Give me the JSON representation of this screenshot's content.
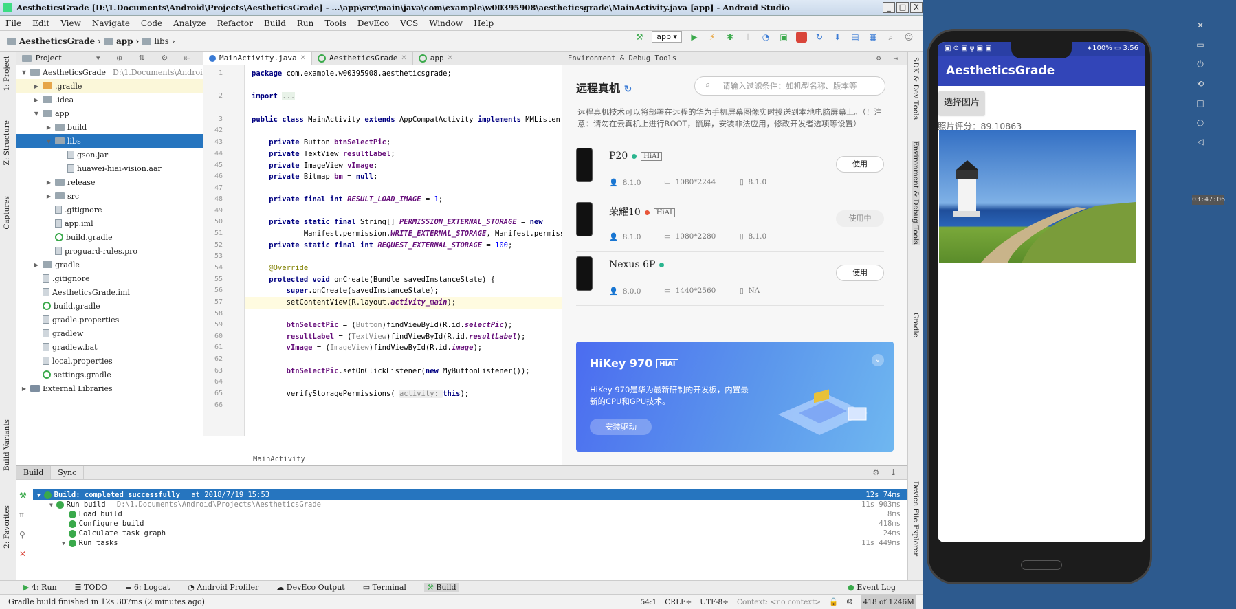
{
  "window": {
    "title": "AestheticsGrade [D:\\1.Documents\\Android\\Projects\\AestheticsGrade] - ...\\app\\src\\main\\java\\com\\example\\w00395908\\aestheticsgrade\\MainActivity.java [app] - Android Studio",
    "min": "_",
    "max": "□",
    "close": "X"
  },
  "menu": [
    "File",
    "Edit",
    "View",
    "Navigate",
    "Code",
    "Analyze",
    "Refactor",
    "Build",
    "Run",
    "Tools",
    "DevEco",
    "VCS",
    "Window",
    "Help"
  ],
  "breadcrumb": [
    "AestheticsGrade",
    "app",
    "libs"
  ],
  "run_config": "app",
  "left_tabs": [
    "1: Project",
    "Z: Structure",
    "Captures",
    "Build Variants",
    "2: Favorites"
  ],
  "right_tabs": [
    "SDK & Dev Tools",
    "Environment & Debug Tools",
    "Gradle",
    "Device File Explorer"
  ],
  "project": {
    "header": "Project",
    "tree": [
      {
        "label": "AestheticsGrade",
        "extra": "D:\\1.Documents\\Androi",
        "indent": 0,
        "arrow": "▼",
        "icon": "folder"
      },
      {
        "label": ".gradle",
        "indent": 1,
        "arrow": "▶",
        "icon": "folder-or",
        "hl": true
      },
      {
        "label": ".idea",
        "indent": 1,
        "arrow": "▶",
        "icon": "folder"
      },
      {
        "label": "app",
        "indent": 1,
        "arrow": "▼",
        "icon": "folder"
      },
      {
        "label": "build",
        "indent": 2,
        "arrow": "▶",
        "icon": "folder"
      },
      {
        "label": "libs",
        "indent": 2,
        "arrow": "▼",
        "icon": "folder",
        "sel": true
      },
      {
        "label": "gson.jar",
        "indent": 3,
        "arrow": "",
        "icon": "file"
      },
      {
        "label": "huawei-hiai-vision.aar",
        "indent": 3,
        "arrow": "",
        "icon": "file"
      },
      {
        "label": "release",
        "indent": 2,
        "arrow": "▶",
        "icon": "folder"
      },
      {
        "label": "src",
        "indent": 2,
        "arrow": "▶",
        "icon": "folder"
      },
      {
        "label": ".gitignore",
        "indent": 2,
        "arrow": "",
        "icon": "file"
      },
      {
        "label": "app.iml",
        "indent": 2,
        "arrow": "",
        "icon": "file"
      },
      {
        "label": "build.gradle",
        "indent": 2,
        "arrow": "",
        "icon": "gradle"
      },
      {
        "label": "proguard-rules.pro",
        "indent": 2,
        "arrow": "",
        "icon": "file"
      },
      {
        "label": "gradle",
        "indent": 1,
        "arrow": "▶",
        "icon": "folder"
      },
      {
        "label": ".gitignore",
        "indent": 1,
        "arrow": "",
        "icon": "file"
      },
      {
        "label": "AestheticsGrade.iml",
        "indent": 1,
        "arrow": "",
        "icon": "file"
      },
      {
        "label": "build.gradle",
        "indent": 1,
        "arrow": "",
        "icon": "gradle"
      },
      {
        "label": "gradle.properties",
        "indent": 1,
        "arrow": "",
        "icon": "file"
      },
      {
        "label": "gradlew",
        "indent": 1,
        "arrow": "",
        "icon": "file"
      },
      {
        "label": "gradlew.bat",
        "indent": 1,
        "arrow": "",
        "icon": "file"
      },
      {
        "label": "local.properties",
        "indent": 1,
        "arrow": "",
        "icon": "file"
      },
      {
        "label": "settings.gradle",
        "indent": 1,
        "arrow": "",
        "icon": "gradle"
      },
      {
        "label": "External Libraries",
        "indent": 0,
        "arrow": "▶",
        "icon": "lib"
      }
    ]
  },
  "editor": {
    "tabs": [
      "MainActivity.java",
      "AestheticsGrade",
      "app"
    ],
    "line_numbers": [
      "1",
      "2",
      "3",
      "42",
      "43",
      "44",
      "45",
      "46",
      "47",
      "48",
      "49",
      "50",
      "51",
      "52",
      "53",
      "54",
      "55",
      "56",
      "57",
      "58",
      "59",
      "60",
      "61",
      "62",
      "63",
      "64",
      "65",
      "66"
    ],
    "footer": "MainActivity"
  },
  "env": {
    "header": "Environment & Debug Tools",
    "title": "远程真机",
    "search_placeholder": "请输入过滤条件：如机型名称、版本等",
    "desc": "远程真机技术可以将部署在远程的华为手机屏幕图像实时投送到本地电脑屏幕上。（！注意：请勿在云真机上进行ROOT，锁屏，安装非法应用，修改开发者选项等设置）",
    "devices": [
      {
        "name": "P20",
        "hiai": "HiAI",
        "status_color": "#2bb58f",
        "os": "8.1.0",
        "res": "1080*2244",
        "emui": "8.1.0",
        "btn": "使用",
        "busy": false
      },
      {
        "name": "荣耀10",
        "hiai": "HiAI",
        "status_color": "#e8563a",
        "os": "8.1.0",
        "res": "1080*2280",
        "emui": "8.1.0",
        "btn": "使用中",
        "busy": true
      },
      {
        "name": "Nexus 6P",
        "hiai": "",
        "status_color": "#2bb58f",
        "os": "8.0.0",
        "res": "1440*2560",
        "emui": "NA",
        "btn": "使用",
        "busy": false
      }
    ],
    "promo": {
      "title": "HiKey 970",
      "badge": "HiAI",
      "desc": "HiKey 970是华为最新研制的开发板，内置最新的CPU和GPU技术。",
      "btn": "安装驱动"
    }
  },
  "build": {
    "tabs": [
      "Build",
      "Sync"
    ],
    "rows": [
      {
        "label": "Build: completed successfully",
        "extra": "at 2018/7/19 15:53",
        "time": "12s 74ms",
        "indent": 0,
        "sel": true
      },
      {
        "label": "Run build",
        "extra": "D:\\1.Documents\\Android\\Projects\\AestheticsGrade",
        "time": "11s 903ms",
        "indent": 1
      },
      {
        "label": "Load build",
        "extra": "",
        "time": "8ms",
        "indent": 2
      },
      {
        "label": "Configure build",
        "extra": "",
        "time": "418ms",
        "indent": 2
      },
      {
        "label": "Calculate task graph",
        "extra": "",
        "time": "24ms",
        "indent": 2
      },
      {
        "label": "Run tasks",
        "extra": "",
        "time": "11s 449ms",
        "indent": 2
      }
    ]
  },
  "bottom_tabs": [
    "4: Run",
    "TODO",
    "6: Logcat",
    "Android Profiler",
    "DevEco Output",
    "Terminal",
    "Build"
  ],
  "event_log": "Event Log",
  "status": {
    "message": "Gradle build finished in 12s 307ms (2 minutes ago)",
    "pos": "54:1",
    "crlf": "CRLF÷",
    "enc": "UTF-8÷",
    "context": "Context: <no context>",
    "mem": "418 of 1246M"
  },
  "phone": {
    "status_left": "▣ ⊙ ▣ ψ ▣ ▣",
    "status_right": "∗100% ▭ 3:56",
    "app_title": "AestheticsGrade",
    "button": "选择图片",
    "score": "照片评分：89.10863"
  },
  "emulator_clock": "03:47:06"
}
